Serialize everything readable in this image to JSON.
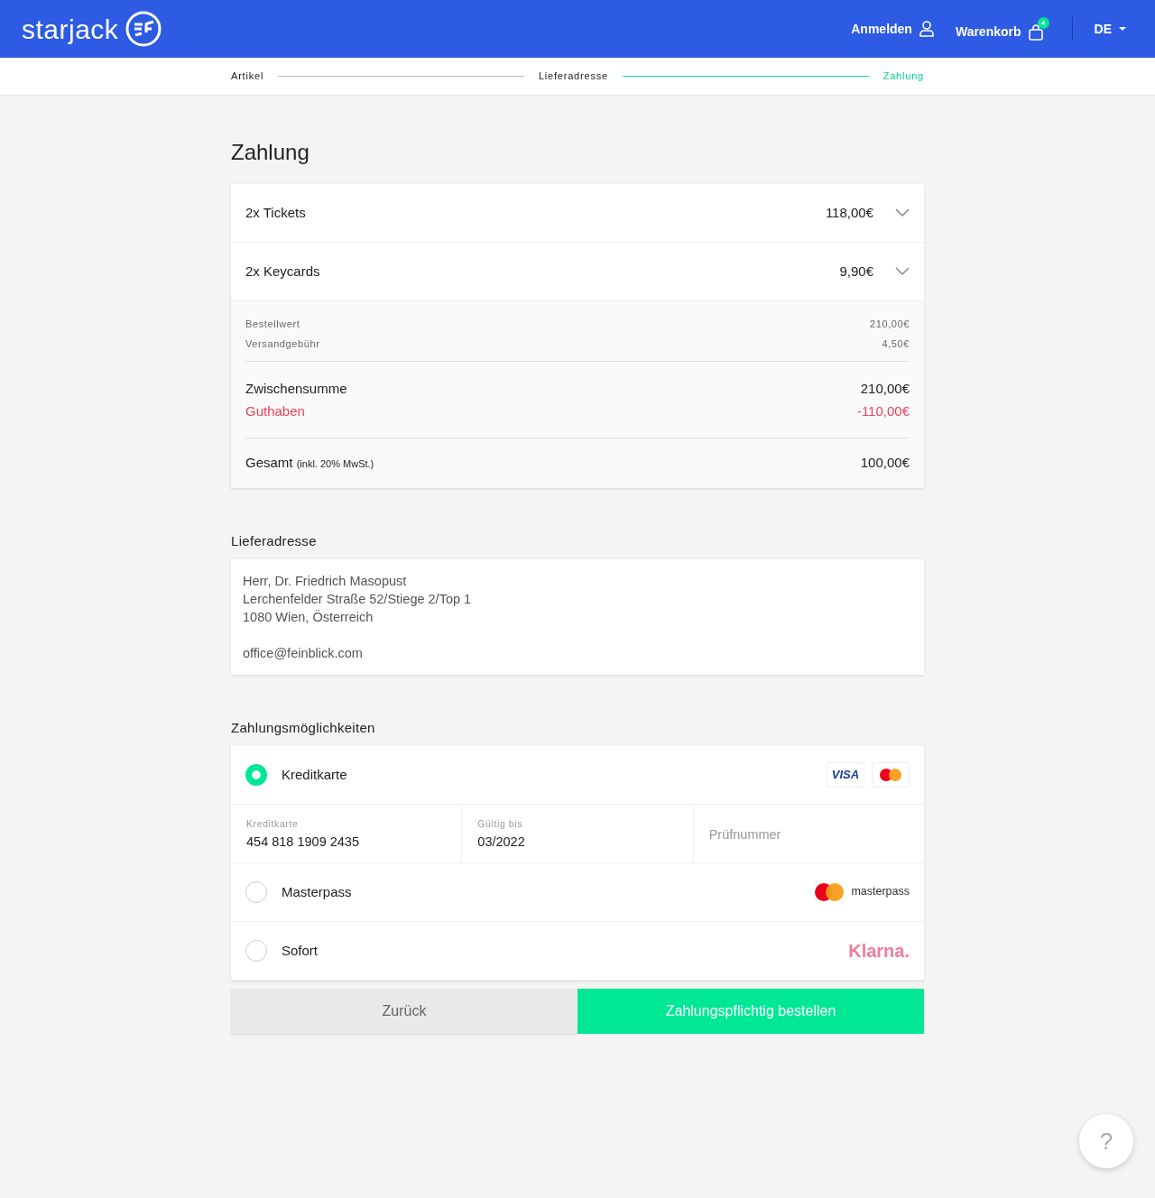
{
  "header": {
    "logo": "starjack",
    "login": "Anmelden",
    "cart": "Warenkorb",
    "cart_count": "4",
    "language": "DE"
  },
  "steps": [
    {
      "label": "Artikel",
      "selected": false
    },
    {
      "label": "Lieferadresse",
      "selected": false
    },
    {
      "label": "Zahlung",
      "selected": true
    }
  ],
  "title": "Zahlung",
  "order": {
    "items": [
      {
        "label": "2x Tickets",
        "price": "118,00€",
        "expanded": false
      },
      {
        "label": "2x Keycards",
        "price": "9,90€",
        "expanded": false
      }
    ],
    "details": [
      {
        "label": "Bestellwert",
        "value": "210,00€"
      },
      {
        "label": "Versandgebühr",
        "value": "4,50€"
      }
    ],
    "subtotals": [
      {
        "label": "Zwischensumme",
        "value": "210,00€",
        "kind": "normal"
      },
      {
        "label": "Guthaben",
        "value": "-110,00€",
        "kind": "credit"
      }
    ],
    "total": {
      "label": "Gesamt",
      "note": "(inkl. 20% MwSt.)",
      "value": "100,00€"
    }
  },
  "address": {
    "heading": "Lieferadresse",
    "lines": [
      "Herr, Dr. Friedrich Masopust",
      "Lerchenfelder Straße 52/Stiege 2/Top 1",
      "1080 Wien, Österreich"
    ],
    "email": "office@feinblick.com"
  },
  "payment": {
    "heading": "Zahlungsmöglichkeiten",
    "methods": [
      {
        "label": "Kreditkarte",
        "selected": true,
        "kind": "cards",
        "logo": "VISA",
        "fields": [
          {
            "label": "Kreditkarte",
            "value": "454 818 1909 2435"
          },
          {
            "label": "Gültig bis",
            "value": "03/2022"
          },
          {
            "placeholder": "Prüfnummer"
          }
        ]
      },
      {
        "label": "Masterpass",
        "selected": false,
        "kind": "masterpass",
        "logo": "masterpass"
      },
      {
        "label": "Sofort",
        "selected": false,
        "kind": "klarna",
        "logo": "Klarna."
      }
    ]
  },
  "buttons": {
    "back": "Zurück",
    "order": "Zahlungspflichtig bestellen"
  },
  "help": "?"
}
